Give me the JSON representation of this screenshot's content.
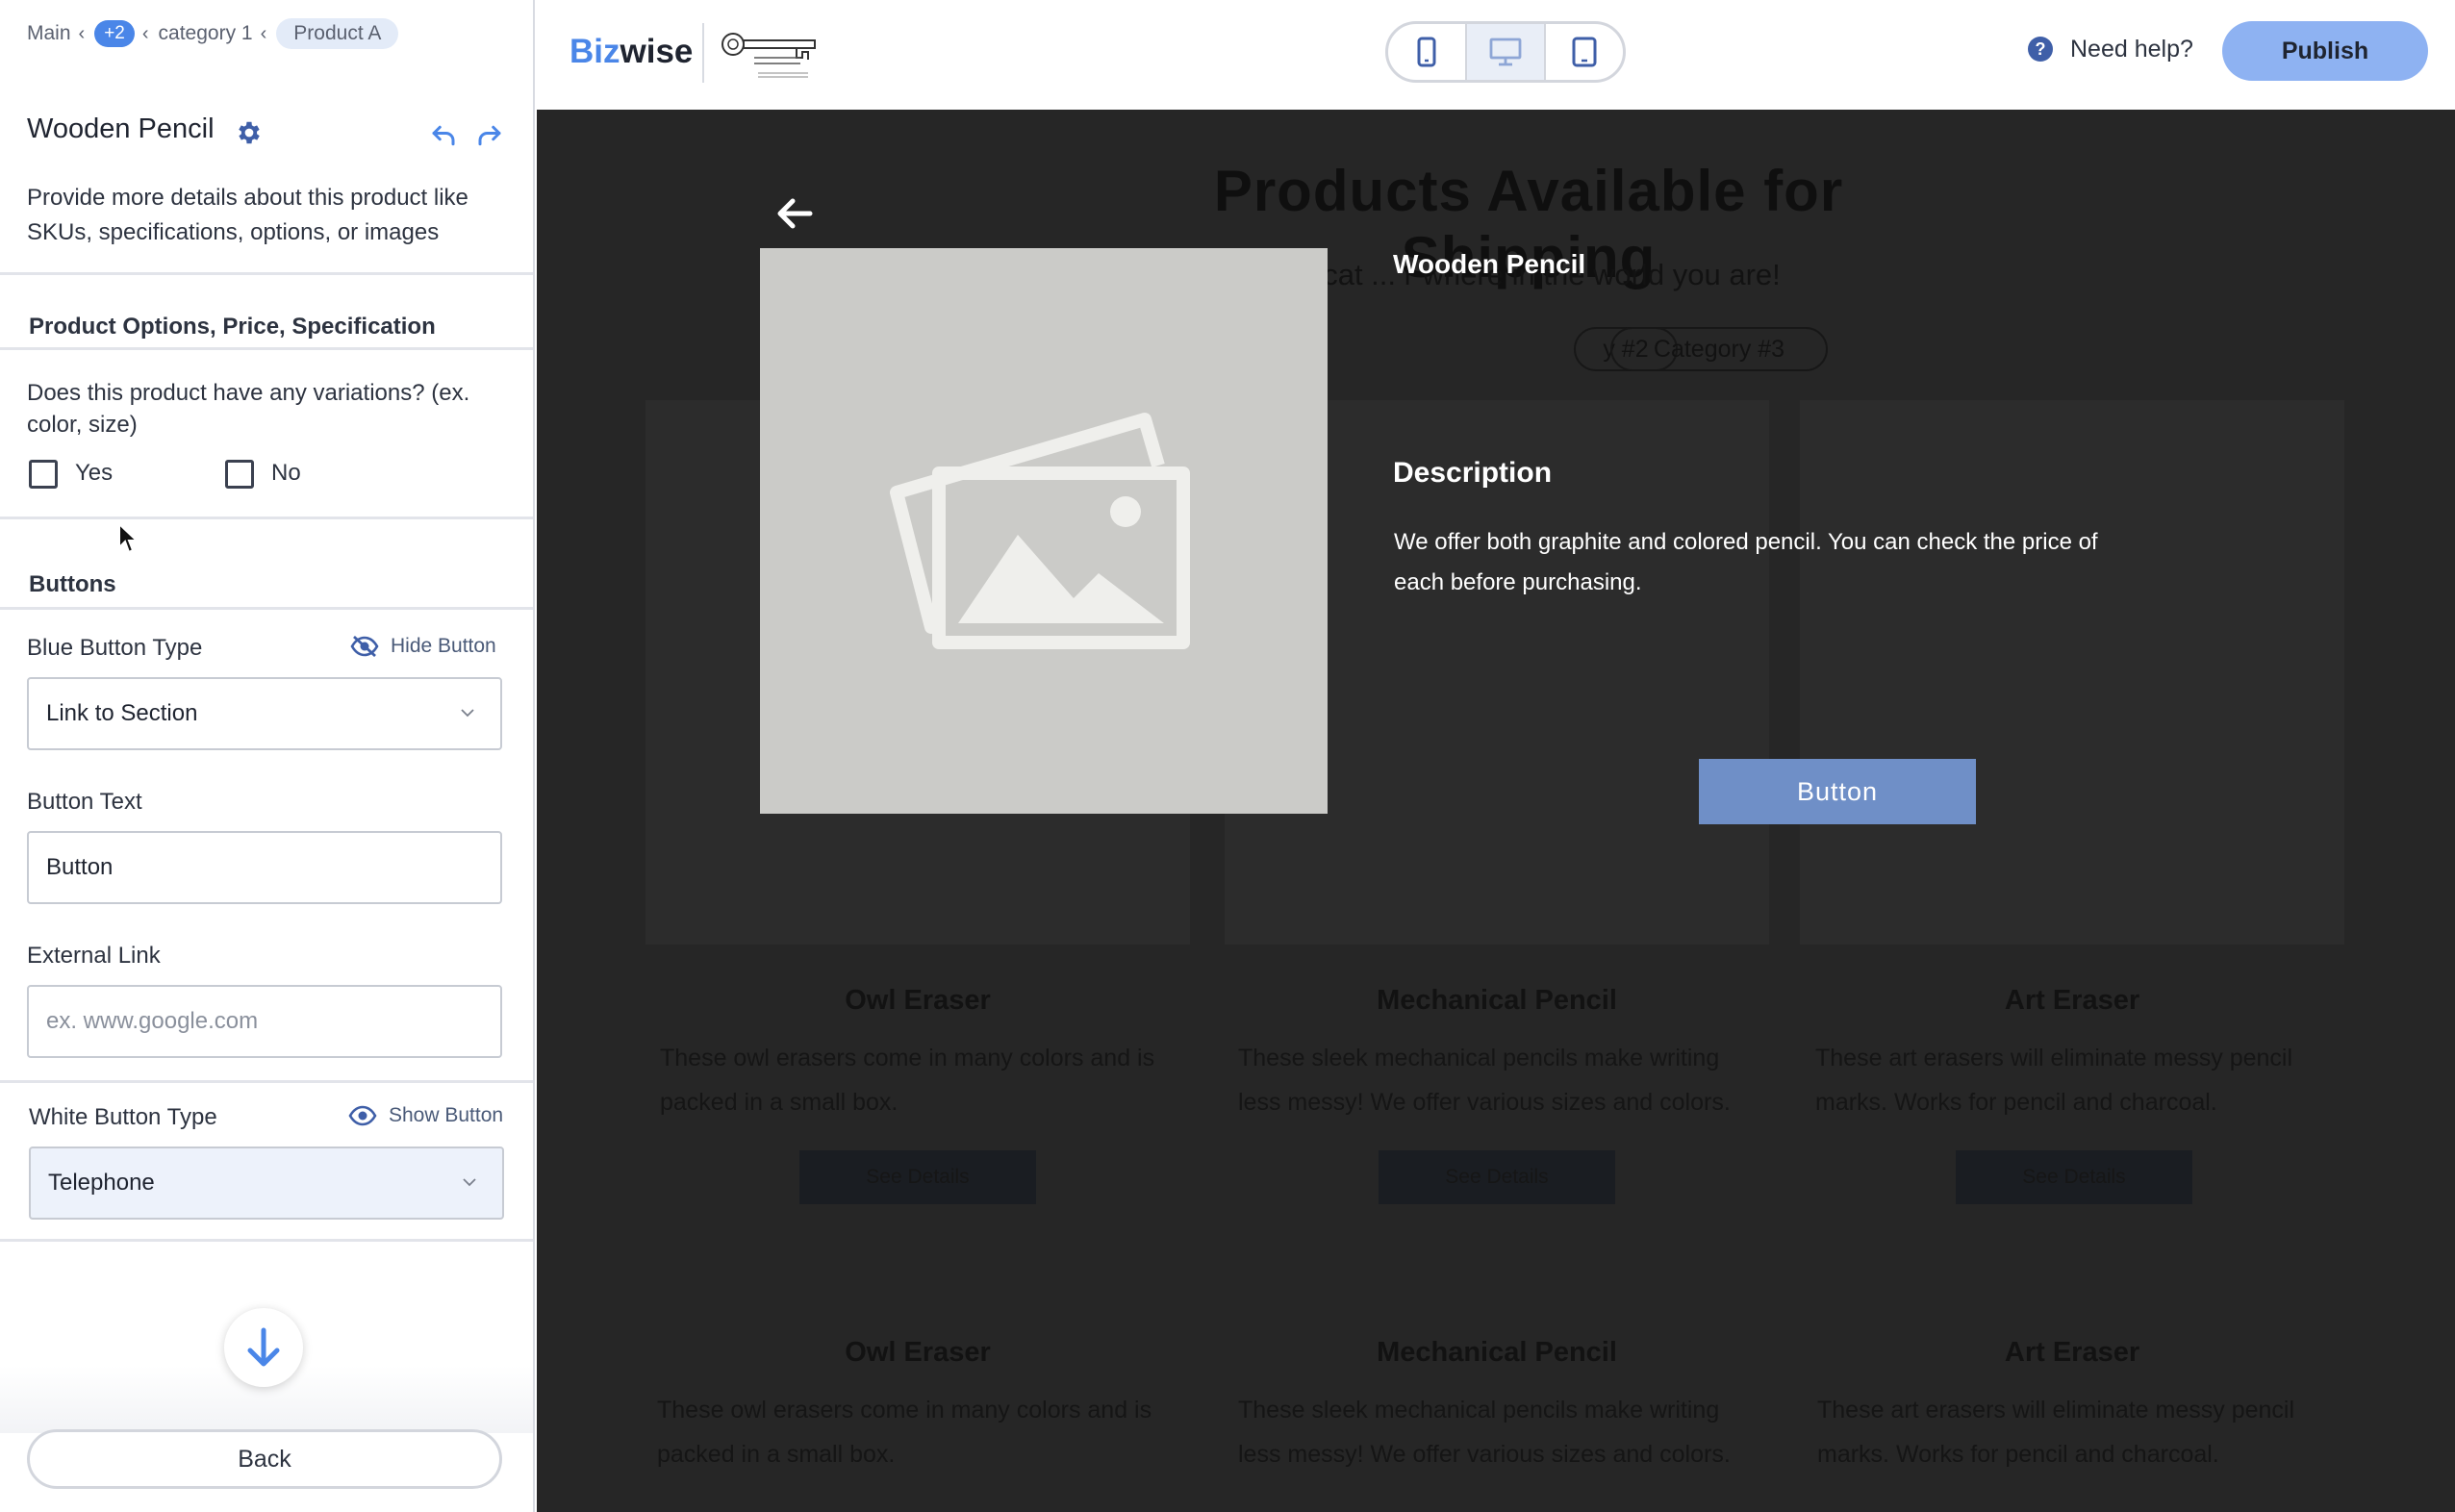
{
  "breadcrumb": {
    "items": [
      "Main",
      "category 1"
    ],
    "hidden_count": "+2",
    "current": "Product A"
  },
  "product": {
    "title": "Wooden Pencil",
    "description": "Provide more details about this product like SKUs, specifications, options, or images"
  },
  "options_section": {
    "title": "Product Options, Price, Specification",
    "variations_question": "Does this product have any variations? (ex. color, size)",
    "yes_label": "Yes",
    "no_label": "No"
  },
  "buttons_section": {
    "title": "Buttons",
    "blue_button_type_label": "Blue Button Type",
    "hide_button_label": "Hide Button",
    "blue_button_type_value": "Link to Section",
    "button_text_label": "Button Text",
    "button_text_value": "Button",
    "external_link_label": "External Link",
    "external_link_placeholder": "ex. www.google.com",
    "white_button_type_label": "White Button Type",
    "show_button_label": "Show Button",
    "white_button_type_value": "Telephone"
  },
  "footer": {
    "back_label": "Back"
  },
  "topbar": {
    "logo_blue": "Biz",
    "logo_dark": "wise",
    "help_label": "Need help?",
    "publish_label": "Publish",
    "devices": [
      "mobile-icon",
      "desktop-icon",
      "tablet-icon"
    ],
    "active_device": "desktop-icon"
  },
  "background_page": {
    "heading": "Products Available for Shipping",
    "subtitle_visible": "uct cat ... r where in the world you are!",
    "category_pills": [
      "y #2",
      "Category #3"
    ],
    "cards": [
      {
        "title": "Owl Eraser",
        "desc": "These owl erasers come in many colors and is packed in a small box.",
        "btn": "See Details"
      },
      {
        "title": "Mechanical Pencil",
        "desc": "These sleek mechanical pencils make writing less messy! We offer various sizes and colors.",
        "btn": "See Details"
      },
      {
        "title": "Art Eraser",
        "desc": "These art erasers will eliminate messy pencil marks. Works for pencil and charcoal.",
        "btn": "See Details"
      }
    ]
  },
  "modal": {
    "title": "Wooden Pencil",
    "description_heading": "Description",
    "description": "We offer both graphite and colored pencil. You can check the price of each before purchasing.",
    "button_label": "Button"
  },
  "colors": {
    "accent": "#4a86e8",
    "publish_bg": "#8eb2f2",
    "modal_button": "#6f8fc7",
    "overlay": "#262626"
  }
}
